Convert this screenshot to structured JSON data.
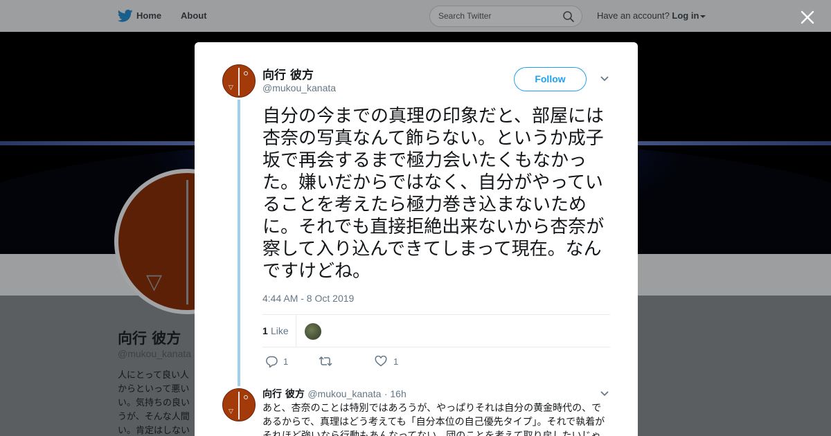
{
  "topbar": {
    "home_label": "Home",
    "about_label": "About",
    "search_placeholder": "Search Twitter",
    "account_prompt": "Have an account?",
    "login_label": "Log in"
  },
  "profile": {
    "name": "向行 彼方",
    "handle": "@mukou_kanata",
    "bio_partial": "人にとって良い人\nからといって悪い\nい。気持ちの良い\nうが、そんな人間\nい。肯定はしない"
  },
  "tweet": {
    "author_name": "向行 彼方",
    "author_handle": "@mukou_kanata",
    "follow_label": "Follow",
    "text": "自分の今までの真理の印象だと、部屋には杏奈の写真なんて飾らない。というか成子坂で再会するまで極力会いたくもなかった。嫌いだからではなく、自分がやっていることを考えたら極力巻き込まないために。それでも直接拒絶出来ないから杏奈が察して入り込んできてしまって現在。なんですけどね。",
    "timestamp": "4:44 AM - 8 Oct 2019",
    "like_count": "1",
    "like_label": "Like",
    "actions": {
      "reply_count": "1",
      "retweet_count": "",
      "like_count": "1"
    }
  },
  "reply": {
    "author_name": "向行 彼方",
    "author_handle": "@mukou_kanata",
    "time_ago": "· 16h",
    "text": "あと、杏奈のことは特別ではあろうが、やっぱりそれは自分の黄金時代の、であるからで、真理はどう考えても「自分本位の自己優先タイプ」。それで執着がそれほど強いなら行動もあんなってない。団のことを考えて取り戻したいじゃ"
  },
  "colors": {
    "accent": "#1da1f2",
    "thread_line": "#9fd0ee",
    "muted": "#657786"
  }
}
